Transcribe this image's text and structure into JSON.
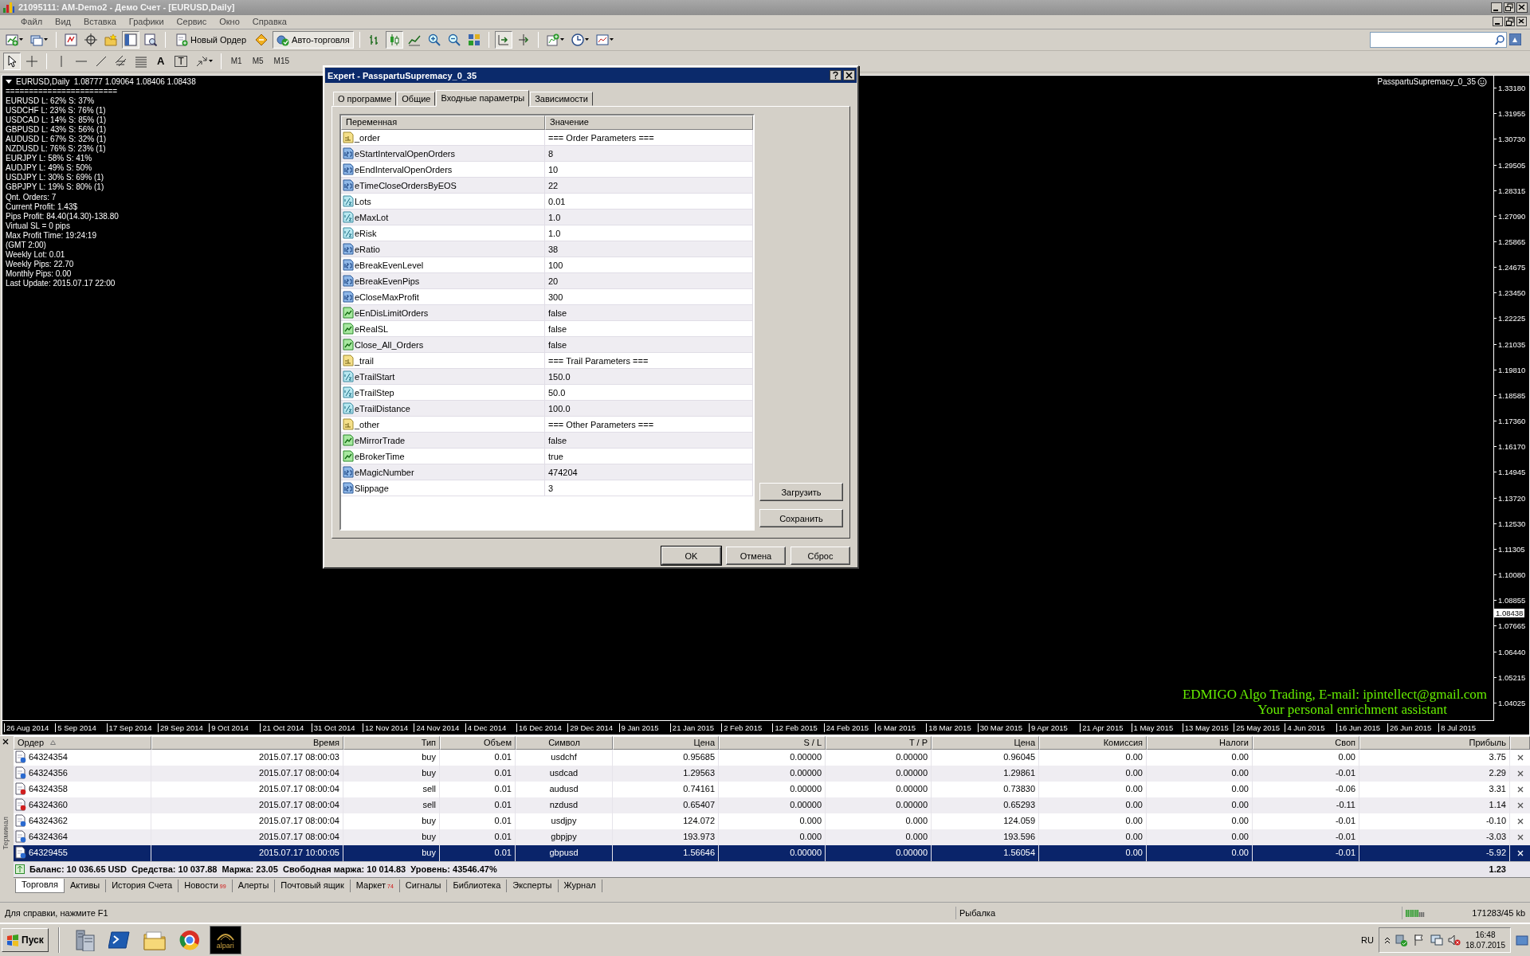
{
  "window": {
    "title": "21095111: AM-Demo2 - Демо Счет - [EURUSD,Daily]"
  },
  "menu": [
    "Файл",
    "Вид",
    "Вставка",
    "Графики",
    "Сервис",
    "Окно",
    "Справка"
  ],
  "toolbar": {
    "new_order": "Новый Ордер",
    "auto_trading": {
      "label": "Авто-торговля",
      "on": true
    },
    "candlesticks_on": true,
    "auto_scroll_on": true,
    "cursor_on": true,
    "text_tool": "A",
    "label_tool": "T",
    "timeframes": [
      "M1",
      "M5",
      "M15"
    ]
  },
  "chart": {
    "header": "EURUSD,Daily  1.08777 1.09064 1.08406 1.08438",
    "info_lines": [
      "========================",
      "EURUSD L: 62% S: 37%",
      "USDCHF L: 23% S: 76% (1)",
      "USDCAD L: 14% S: 85% (1)",
      "GBPUSD L: 43% S: 56% (1)",
      "AUDUSD L: 67% S: 32% (1)",
      "NZDUSD L: 76% S: 23% (1)",
      "EURJPY L: 58% S: 41%",
      "AUDJPY L: 49% S: 50%",
      "USDJPY L: 30% S: 69% (1)",
      "GBPJPY L: 19% S: 80% (1)",
      "Qnt. Orders: 7",
      "Current Profit: 1.43$",
      "Pips Profit: 84.40(14.30)-138.80",
      "Virtual SL = 0 pips",
      "Max Profit Time: 19:24:19",
      "(GMT 2:00)",
      "Weekly Lot: 0.01",
      "Weekly Pips: 22.70",
      "Monthly Pips: 0.00",
      "Last Update: 2015.07.17 22:00"
    ],
    "expert_name": "PasspartuSupremacy_0_35",
    "banner": [
      "EDMIGO Algo Trading, E-mail: ipintellect@gmail.com",
      "Your personal enrichment assistant"
    ],
    "price_axis": [
      {
        "label": "1.33180",
        "current": false
      },
      {
        "label": "1.31955",
        "current": false
      },
      {
        "label": "1.30730",
        "current": false
      },
      {
        "label": "1.29505",
        "current": false
      },
      {
        "label": "1.28315",
        "current": false
      },
      {
        "label": "1.27090",
        "current": false
      },
      {
        "label": "1.25865",
        "current": false
      },
      {
        "label": "1.24675",
        "current": false
      },
      {
        "label": "1.23450",
        "current": false
      },
      {
        "label": "1.22225",
        "current": false
      },
      {
        "label": "1.21035",
        "current": false
      },
      {
        "label": "1.19810",
        "current": false
      },
      {
        "label": "1.18585",
        "current": false
      },
      {
        "label": "1.17360",
        "current": false
      },
      {
        "label": "1.16170",
        "current": false
      },
      {
        "label": "1.14945",
        "current": false
      },
      {
        "label": "1.13720",
        "current": false
      },
      {
        "label": "1.12530",
        "current": false
      },
      {
        "label": "1.11305",
        "current": false
      },
      {
        "label": "1.10080",
        "current": false
      },
      {
        "label": "1.08855",
        "current": false
      },
      {
        "label": "1.08438",
        "current": true
      },
      {
        "label": "1.07665",
        "current": false
      },
      {
        "label": "1.06440",
        "current": false
      },
      {
        "label": "1.05215",
        "current": false
      },
      {
        "label": "1.04025",
        "current": false
      }
    ],
    "date_axis": [
      "26 Aug 2014",
      "5 Sep 2014",
      "17 Sep 2014",
      "29 Sep 2014",
      "9 Oct 2014",
      "21 Oct 2014",
      "31 Oct 2014",
      "12 Nov 2014",
      "24 Nov 2014",
      "4 Dec 2014",
      "16 Dec 2014",
      "29 Dec 2014",
      "9 Jan 2015",
      "21 Jan 2015",
      "2 Feb 2015",
      "12 Feb 2015",
      "24 Feb 2015",
      "6 Mar 2015",
      "18 Mar 2015",
      "30 Mar 2015",
      "9 Apr 2015",
      "21 Apr 2015",
      "1 May 2015",
      "13 May 2015",
      "25 May 2015",
      "4 Jun 2015",
      "16 Jun 2015",
      "26 Jun 2015",
      "8 Jul 2015"
    ]
  },
  "dialog": {
    "title": "Expert - PasspartuSupremacy_0_35",
    "tabs": [
      {
        "label": "О программе",
        "selected": false
      },
      {
        "label": "Общие",
        "selected": false
      },
      {
        "label": "Входные параметры",
        "selected": true
      },
      {
        "label": "Зависимости",
        "selected": false
      }
    ],
    "columns": [
      "Переменная",
      "Значение"
    ],
    "params": [
      {
        "kind": "string",
        "name": "_order",
        "value": "=== Order Parameters ==="
      },
      {
        "kind": "int",
        "name": "eStartIntervalOpenOrders",
        "value": "8"
      },
      {
        "kind": "int",
        "name": "eEndIntervalOpenOrders",
        "value": "10"
      },
      {
        "kind": "int",
        "name": "eTimeCloseOrdersByEOS",
        "value": "22"
      },
      {
        "kind": "double",
        "name": "Lots",
        "value": "0.01"
      },
      {
        "kind": "double",
        "name": "eMaxLot",
        "value": "1.0"
      },
      {
        "kind": "double",
        "name": "eRisk",
        "value": "1.0"
      },
      {
        "kind": "int",
        "name": "eRatio",
        "value": "38"
      },
      {
        "kind": "int",
        "name": "eBreakEvenLevel",
        "value": "100"
      },
      {
        "kind": "int",
        "name": "eBreakEvenPips",
        "value": "20"
      },
      {
        "kind": "int",
        "name": "eCloseMaxProfit",
        "value": "300"
      },
      {
        "kind": "bool",
        "name": "eEnDisLimitOrders",
        "value": "false"
      },
      {
        "kind": "bool",
        "name": "eRealSL",
        "value": "false"
      },
      {
        "kind": "bool",
        "name": "Close_All_Orders",
        "value": "false"
      },
      {
        "kind": "string",
        "name": "_trail",
        "value": "=== Trail Parameters ==="
      },
      {
        "kind": "double",
        "name": "eTrailStart",
        "value": "150.0"
      },
      {
        "kind": "double",
        "name": "eTrailStep",
        "value": "50.0"
      },
      {
        "kind": "double",
        "name": "eTrailDistance",
        "value": "100.0"
      },
      {
        "kind": "string",
        "name": "_other",
        "value": "=== Other Parameters ==="
      },
      {
        "kind": "bool",
        "name": "eMirrorTrade",
        "value": "false"
      },
      {
        "kind": "bool",
        "name": "eBrokerTime",
        "value": "true"
      },
      {
        "kind": "int",
        "name": "eMagicNumber",
        "value": "474204"
      },
      {
        "kind": "int",
        "name": "Slippage",
        "value": "3"
      }
    ],
    "side_buttons": [
      "Загрузить",
      "Сохранить"
    ],
    "buttons": [
      "OK",
      "Отмена",
      "Сброс"
    ]
  },
  "terminal": {
    "label": "Терминал",
    "columns": [
      "Ордер",
      "Время",
      "Тип",
      "Объем",
      "Символ",
      "Цена",
      "S / L",
      "T / P",
      "Цена",
      "Комиссия",
      "Налоги",
      "Своп",
      "Прибыль"
    ],
    "rows": [
      {
        "kind": "buy",
        "selected": false,
        "cells": [
          "64324354",
          "2015.07.17 08:00:03",
          "buy",
          "0.01",
          "usdchf",
          "0.95685",
          "0.00000",
          "0.00000",
          "0.96045",
          "0.00",
          "0.00",
          "0.00",
          "3.75"
        ]
      },
      {
        "kind": "buy",
        "selected": false,
        "cells": [
          "64324356",
          "2015.07.17 08:00:04",
          "buy",
          "0.01",
          "usdcad",
          "1.29563",
          "0.00000",
          "0.00000",
          "1.29861",
          "0.00",
          "0.00",
          "-0.01",
          "2.29"
        ]
      },
      {
        "kind": "sell",
        "selected": false,
        "cells": [
          "64324358",
          "2015.07.17 08:00:04",
          "sell",
          "0.01",
          "audusd",
          "0.74161",
          "0.00000",
          "0.00000",
          "0.73830",
          "0.00",
          "0.00",
          "-0.06",
          "3.31"
        ]
      },
      {
        "kind": "sell",
        "selected": false,
        "cells": [
          "64324360",
          "2015.07.17 08:00:04",
          "sell",
          "0.01",
          "nzdusd",
          "0.65407",
          "0.00000",
          "0.00000",
          "0.65293",
          "0.00",
          "0.00",
          "-0.11",
          "1.14"
        ]
      },
      {
        "kind": "buy",
        "selected": false,
        "cells": [
          "64324362",
          "2015.07.17 08:00:04",
          "buy",
          "0.01",
          "usdjpy",
          "124.072",
          "0.000",
          "0.000",
          "124.059",
          "0.00",
          "0.00",
          "-0.01",
          "-0.10"
        ]
      },
      {
        "kind": "buy",
        "selected": false,
        "cells": [
          "64324364",
          "2015.07.17 08:00:04",
          "buy",
          "0.01",
          "gbpjpy",
          "193.973",
          "0.000",
          "0.000",
          "193.596",
          "0.00",
          "0.00",
          "-0.01",
          "-3.03"
        ]
      },
      {
        "kind": "buy",
        "selected": true,
        "cells": [
          "64329455",
          "2015.07.17 10:00:05",
          "buy",
          "0.01",
          "gbpusd",
          "1.56646",
          "0.00000",
          "0.00000",
          "1.56054",
          "0.00",
          "0.00",
          "-0.01",
          "-5.92"
        ]
      }
    ],
    "summary": "Баланс: 10 036.65 USD  Средства: 10 037.88  Маржа: 23.05  Свободная маржа: 10 014.83  Уровень: 43546.47%",
    "total_profit": "1.23",
    "tabs": [
      {
        "label": "Торговля",
        "selected": true
      },
      {
        "label": "Активы",
        "selected": false
      },
      {
        "label": "История Счета",
        "selected": false
      },
      {
        "label": "Новости",
        "badge": "99",
        "selected": false
      },
      {
        "label": "Алерты",
        "selected": false
      },
      {
        "label": "Почтовый ящик",
        "selected": false
      },
      {
        "label": "Маркет",
        "badge": "74",
        "selected": false
      },
      {
        "label": "Сигналы",
        "selected": false
      },
      {
        "label": "Библиотека",
        "selected": false
      },
      {
        "label": "Эксперты",
        "selected": false
      },
      {
        "label": "Журнал",
        "selected": false
      }
    ]
  },
  "status_bar": {
    "help": "Для справки, нажмите F1",
    "profile": "Рыбалка",
    "traffic": "171283/45 kb"
  },
  "taskbar": {
    "start": "Пуск",
    "active_app": "alpari",
    "language": "RU",
    "time": "16:48",
    "date": "18.07.2015"
  }
}
